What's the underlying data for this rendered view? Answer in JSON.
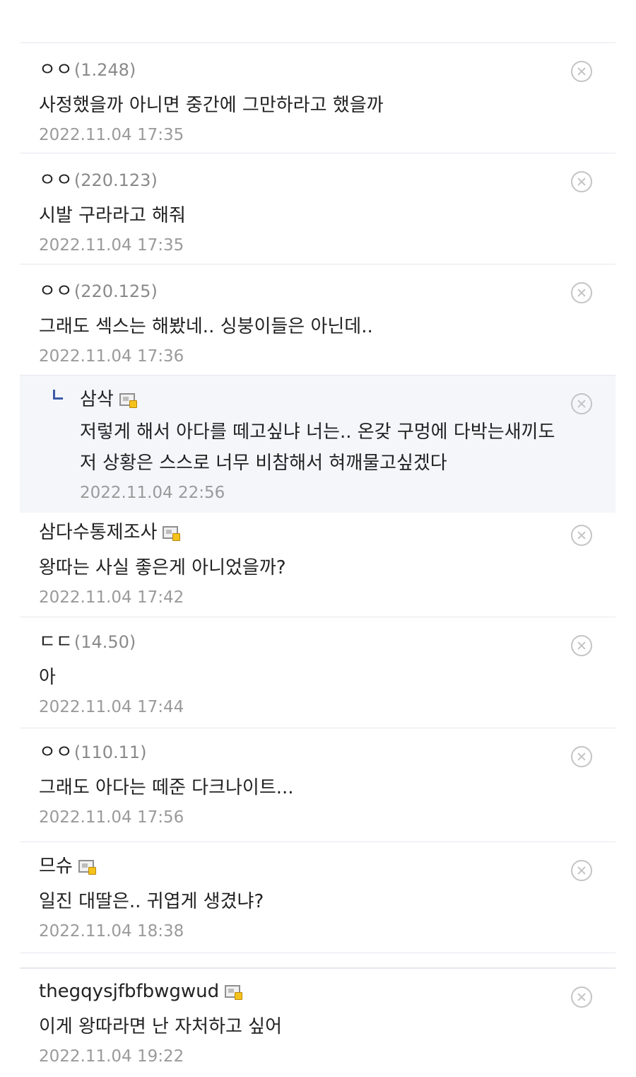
{
  "comments": [
    {
      "name": "ㅇㅇ",
      "ip": "(1.248)",
      "member": false,
      "text": "사정했을까 아니면 중간에 그만하라고 했을까",
      "date": "2022.11.04 17:35"
    },
    {
      "name": "ㅇㅇ",
      "ip": "(220.123)",
      "member": false,
      "text": "시발 구라라고 해줘",
      "date": "2022.11.04 17:35"
    },
    {
      "name": "ㅇㅇ",
      "ip": "(220.125)",
      "member": false,
      "text": "그래도 섹스는 해봤네.. 싱붕이들은 아닌데..",
      "date": "2022.11.04 17:36"
    },
    {
      "name": "삼삭",
      "ip": "",
      "member": true,
      "reply": true,
      "text": "저렇게 해서 아다를 떼고싶냐 너는.. 온갖 구멍에 다박는새끼도 저 상황은 스스로 너무 비참해서 혀깨물고싶겠다",
      "date": "2022.11.04 22:56"
    },
    {
      "name": "삼다수통제조사",
      "ip": "",
      "member": true,
      "text": "왕따는 사실 좋은게 아니었을까?",
      "date": "2022.11.04 17:42"
    },
    {
      "name": "ㄷㄷ",
      "ip": "(14.50)",
      "member": false,
      "text": "아",
      "date": "2022.11.04 17:44"
    },
    {
      "name": "ㅇㅇ",
      "ip": "(110.11)",
      "member": false,
      "text": "그래도 아다는 떼준 다크나이트...",
      "date": "2022.11.04 17:56"
    },
    {
      "name": "므슈",
      "ip": "",
      "member": true,
      "text": "일진 대딸은.. 귀엽게 생겼냐?",
      "date": "2022.11.04 18:38"
    },
    {
      "name": "thegqysjfbfbwgwud",
      "ip": "",
      "member": true,
      "text": "이게 왕따라면 난 자처하고 싶어",
      "date": "2022.11.04 19:22"
    }
  ],
  "icons": {
    "delete": "close-circle-icon",
    "member": "gallery-member-icon",
    "reply": "reply-arrow-icon"
  },
  "colors": {
    "reply_background": "#f4f6fa",
    "divider": "#e6e8ee",
    "date_text": "#9a9a9a",
    "ip_text": "#8a8a8a",
    "reply_arrow": "#3b5aa7"
  }
}
